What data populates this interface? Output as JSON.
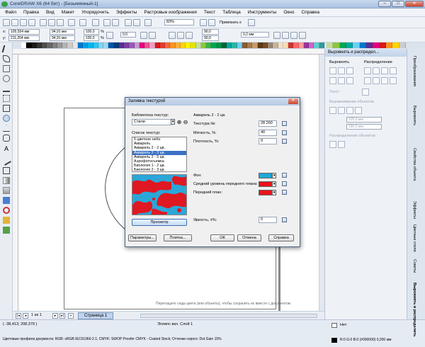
{
  "window": {
    "title": "CorelDRAW X6 (64 бит) - [Безымянный-1]",
    "min": "–",
    "max": "□",
    "close": "✕"
  },
  "menu": [
    "Файл",
    "Правка",
    "Вид",
    "Макет",
    "Упорядочить",
    "Эффекты",
    "Растровые изображения",
    "Текст",
    "Таблица",
    "Инструменты",
    "Окно",
    "Справка"
  ],
  "toolbar1": {
    "zoom": "83%",
    "snap": "Привязать к"
  },
  "toolbar2": {
    "x": "105,554 мм",
    "y": "211,264 мм",
    "w": "94,91 мм",
    "h": "94,91 мм",
    "sx": "100,0",
    "sy": "100,0",
    "pct": "%",
    "angle": "0,0",
    "rot1": "90,0",
    "rot2": "90,0",
    "outline": "0,2 мм"
  },
  "canvas": {
    "hint": "Перетащите сюда цвета (или объекты), чтобы сохранить их вместе с документом"
  },
  "pagebar": {
    "page_count": "1 из 1",
    "page_tab": "Страница 1",
    "page_no": "1"
  },
  "statusbar": {
    "coords": "( -38,413; 208,379 )",
    "object": "Эллипс вкл. Слой 1",
    "profiles": "Цветовые профили документа: RGB: sRGB IEC61966-2.1; CMYK: SWOP Proofer CMYK - Coated Stock; Оттенки серого: Dot Gain 15%",
    "fill": "Нет",
    "outline": "R:0 G:0 B:0 (#000000)  0,200 мм"
  },
  "panel": {
    "header": "Выровнять и распредел...",
    "align_label": "Выровнять",
    "distribute_label": "Распределение",
    "text_label": "Текст",
    "align_objects_label": "Выравнивание объектов",
    "x_val": "105,0 мм",
    "y_val": "190,0 мм",
    "distribute_objects_label": "Распределение объектов"
  },
  "side_tabs": [
    "Преобразования",
    "Выровнять",
    "Свойства объекта",
    "Эффекты",
    "Цветные стили",
    "Советы",
    "Выровнять и распределить"
  ],
  "dialog": {
    "title": "Заливка текстурой",
    "close": "✕",
    "library_label": "Библиотека текстур:",
    "library_value": "Стили",
    "list_label": "Список текстур:",
    "list_items": [
      "5 цветное небо",
      "Акварель",
      "Акварель 2 - 2 цв.",
      "Акварель 2 - 3 цв.",
      "Акварель 2 - 5 цв.",
      "Аэрофотосъемка",
      "Биология 1 - 2 цв.",
      "Биология 2 - 3 цв."
    ],
    "selected_index": 3,
    "texture_name": "Акварель 2 - 2 цв.",
    "texture_no_label": "Текстура №:",
    "texture_no_value": "28 260",
    "softness_label": "Мягкость, %:",
    "softness_value": "40",
    "density_label": "Плотность, %:",
    "density_value": "0",
    "background_label": "Фон:",
    "mid_label": "Средний уровень переднего плана:",
    "fore_label": "Передний план:",
    "brightness_label": "Яркость, ±%:",
    "brightness_value": "0",
    "preview_btn": "Просмотр",
    "params_btn": "Параметры...",
    "tile_btn": "Плитка...",
    "ok_btn": "ОК",
    "cancel_btn": "Отмена",
    "help_btn": "Справка",
    "colors": {
      "background": "#1fa7d6",
      "mid": "#e8131b",
      "fore": "#e8131b",
      "preview_blue": "#2aa7d8",
      "preview_red": "#e01822"
    }
  }
}
